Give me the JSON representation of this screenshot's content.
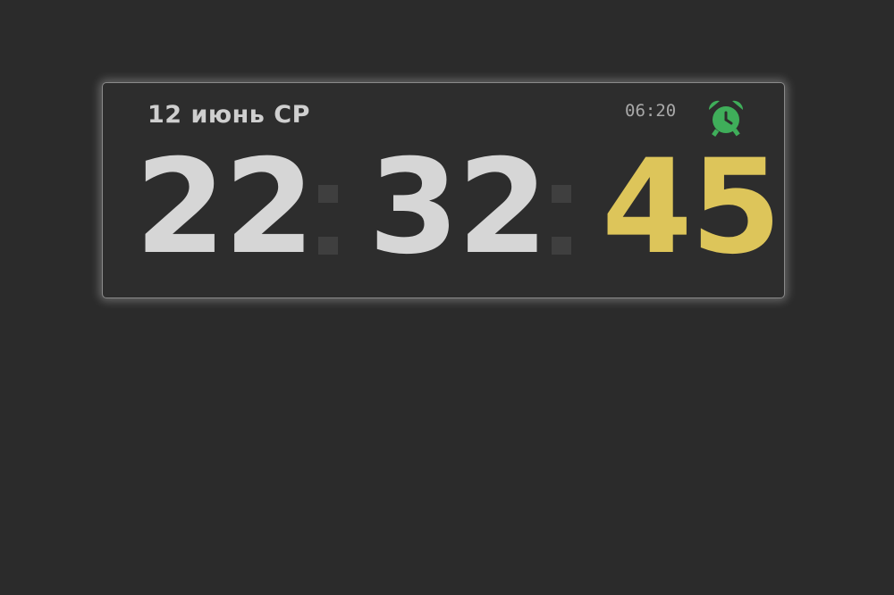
{
  "clock": {
    "date": "12 июнь СР",
    "alarm_time": "06:20",
    "alarm_icon": "alarm-clock-icon",
    "hours": "22",
    "minutes": "32",
    "seconds": "45",
    "colors": {
      "background": "#2b2b2b",
      "digits": "#d6d6d6",
      "seconds": "#ddc55a",
      "alarm_icon": "#3fae5a",
      "separator": "#3f3f3f"
    }
  }
}
